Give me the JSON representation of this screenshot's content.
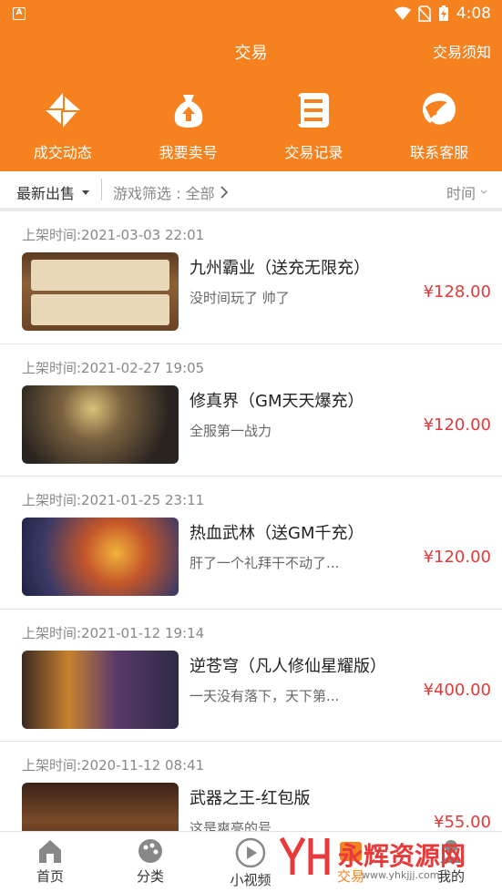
{
  "status_bar": {
    "time": "4:08"
  },
  "header": {
    "title": "交易",
    "notice": "交易须知"
  },
  "quick_actions": [
    {
      "label": "成交动态",
      "icon": "pinwheel-icon"
    },
    {
      "label": "我要卖号",
      "icon": "money-bag-upload-icon"
    },
    {
      "label": "交易记录",
      "icon": "record-list-icon"
    },
    {
      "label": "联系客服",
      "icon": "customer-service-icon"
    }
  ],
  "filters": {
    "latest": "最新出售",
    "game_filter": "游戏筛选 : 全部",
    "sort": "时间"
  },
  "listings": [
    {
      "posted": "上架时间:2021-03-03 22:01",
      "name": "九州霸业（送充无限充）",
      "desc": "没时间玩了 帅了",
      "price": "¥128.00"
    },
    {
      "posted": "上架时间:2021-02-27 19:05",
      "name": "修真界（GM天天爆充）",
      "desc": "全服第一战力",
      "price": "¥120.00"
    },
    {
      "posted": "上架时间:2021-01-25 23:11",
      "name": "热血武林（送GM千充）",
      "desc": "肝了一个礼拜干不动了...",
      "price": "¥120.00"
    },
    {
      "posted": "上架时间:2021-01-12 19:14",
      "name": "逆苍穹（凡人修仙星耀版）",
      "desc": "一天没有落下，天下第...",
      "price": "¥400.00"
    },
    {
      "posted": "上架时间:2020-11-12 08:41",
      "name": "武器之王-红包版",
      "desc": "这是爽亮的号",
      "price": "¥55.00"
    }
  ],
  "tabs": [
    {
      "label": "首页",
      "icon": "home-icon"
    },
    {
      "label": "分类",
      "icon": "palette-icon"
    },
    {
      "label": "小视频",
      "icon": "play-circle-icon"
    },
    {
      "label": "交易",
      "icon": "trade-icon"
    },
    {
      "label": "我的",
      "icon": "person-icon"
    }
  ],
  "watermark": {
    "text": "永辉资源网",
    "url": "www.yhkjjj.com"
  },
  "colors": {
    "brand": "#f5821f",
    "price": "#e03a3a"
  }
}
